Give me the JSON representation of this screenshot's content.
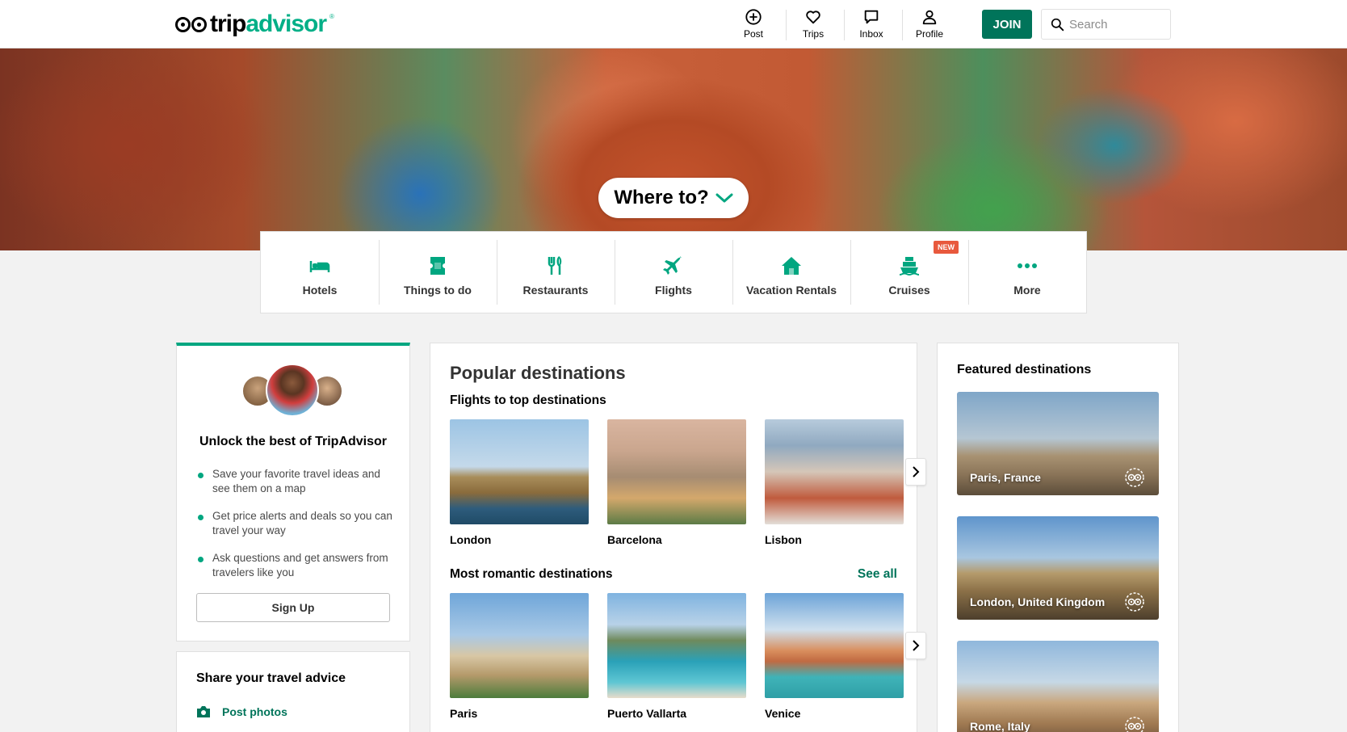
{
  "header": {
    "logo_trip": "trip",
    "logo_advisor": "advisor",
    "logo_mark": "®",
    "nav": [
      {
        "label": "Post",
        "icon": "plus-circle-icon"
      },
      {
        "label": "Trips",
        "icon": "heart-icon"
      },
      {
        "label": "Inbox",
        "icon": "chat-icon"
      },
      {
        "label": "Profile",
        "icon": "person-icon"
      }
    ],
    "join_label": "JOIN",
    "search_placeholder": "Search"
  },
  "hero": {
    "where_to_label": "Where to?"
  },
  "categories": [
    {
      "label": "Hotels",
      "icon": "bed-icon"
    },
    {
      "label": "Things to do",
      "icon": "ticket-icon"
    },
    {
      "label": "Restaurants",
      "icon": "cutlery-icon"
    },
    {
      "label": "Flights",
      "icon": "plane-icon"
    },
    {
      "label": "Vacation Rentals",
      "icon": "house-icon"
    },
    {
      "label": "Cruises",
      "icon": "ship-icon",
      "badge": "NEW"
    },
    {
      "label": "More",
      "icon": "more-dots-icon"
    }
  ],
  "unlock": {
    "title": "Unlock the best of TripAdvisor",
    "benefits": [
      "Save your favorite travel ideas and see them on a map",
      "Get price alerts and deals so you can travel your way",
      "Ask questions and get answers from travelers like you"
    ],
    "signup_label": "Sign Up"
  },
  "share": {
    "title": "Share your travel advice",
    "post_photos_label": "Post photos"
  },
  "popular": {
    "title": "Popular destinations",
    "flights_title": "Flights to top destinations",
    "flights": [
      "London",
      "Barcelona",
      "Lisbon"
    ],
    "romantic_title": "Most romantic destinations",
    "see_all_label": "See all",
    "romantic": [
      "Paris",
      "Puerto Vallarta",
      "Venice"
    ]
  },
  "featured": {
    "title": "Featured destinations",
    "items": [
      "Paris, France",
      "London, United Kingdom",
      "Rome, Italy"
    ]
  },
  "colors": {
    "brand_green": "#00af87",
    "join_green": "#00745a",
    "category_icon": "#00a680",
    "new_badge": "#e8593d"
  }
}
